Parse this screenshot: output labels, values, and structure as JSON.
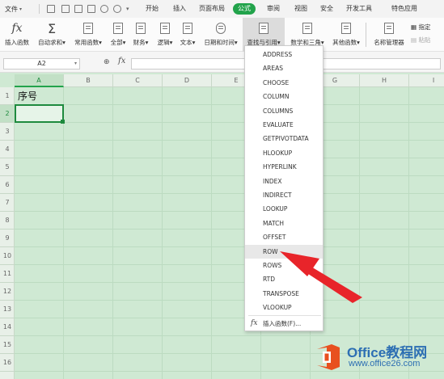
{
  "menubar": {
    "file_label": "文件",
    "tabs": [
      "开始",
      "插入",
      "页面布局",
      "公式",
      "审阅",
      "视图",
      "安全",
      "开发工具",
      "特色应用"
    ],
    "active_tab": "公式"
  },
  "ribbon": {
    "insert_function": "插入函数",
    "autosum": "自动求和",
    "common_functions": "常用函数",
    "all": "全部",
    "financial": "财务",
    "logical": "逻辑",
    "text": "文本",
    "datetime": "日期和时间",
    "lookup_reference": "查找与引用",
    "math_trig": "数学和三角",
    "other_functions": "其他函数",
    "name_manager": "名称管理器",
    "specify": "指定",
    "paste": "粘贴"
  },
  "formula_bar": {
    "name_box": "A2",
    "fx": "fx",
    "formula": ""
  },
  "grid": {
    "columns": [
      "A",
      "B",
      "C",
      "D",
      "E",
      "F",
      "G",
      "H",
      "I"
    ],
    "rows": [
      "1",
      "2",
      "3",
      "4",
      "5",
      "6",
      "7",
      "8",
      "9",
      "10",
      "11",
      "12",
      "13",
      "14",
      "15",
      "16"
    ],
    "a1": "序号"
  },
  "dropdown": {
    "items": [
      "ADDRESS",
      "AREAS",
      "CHOOSE",
      "COLUMN",
      "COLUMNS",
      "EVALUATE",
      "GETPIVOTDATA",
      "HLOOKUP",
      "HYPERLINK",
      "INDEX",
      "INDIRECT",
      "LOOKUP",
      "MATCH",
      "OFFSET",
      "ROW",
      "ROWS",
      "RTD",
      "TRANSPOSE",
      "VLOOKUP"
    ],
    "highlighted": "ROW",
    "insert_function": "插入函数(F)..."
  },
  "watermark": {
    "brand": "Office教程网",
    "url": "www.office26.com"
  },
  "colors": {
    "accent_green": "#22a34b",
    "sheet_green": "#cfe9d3",
    "arrow_red": "#e8242a",
    "brand_blue": "#2d6fb3",
    "logo_orange": "#e8501f"
  }
}
